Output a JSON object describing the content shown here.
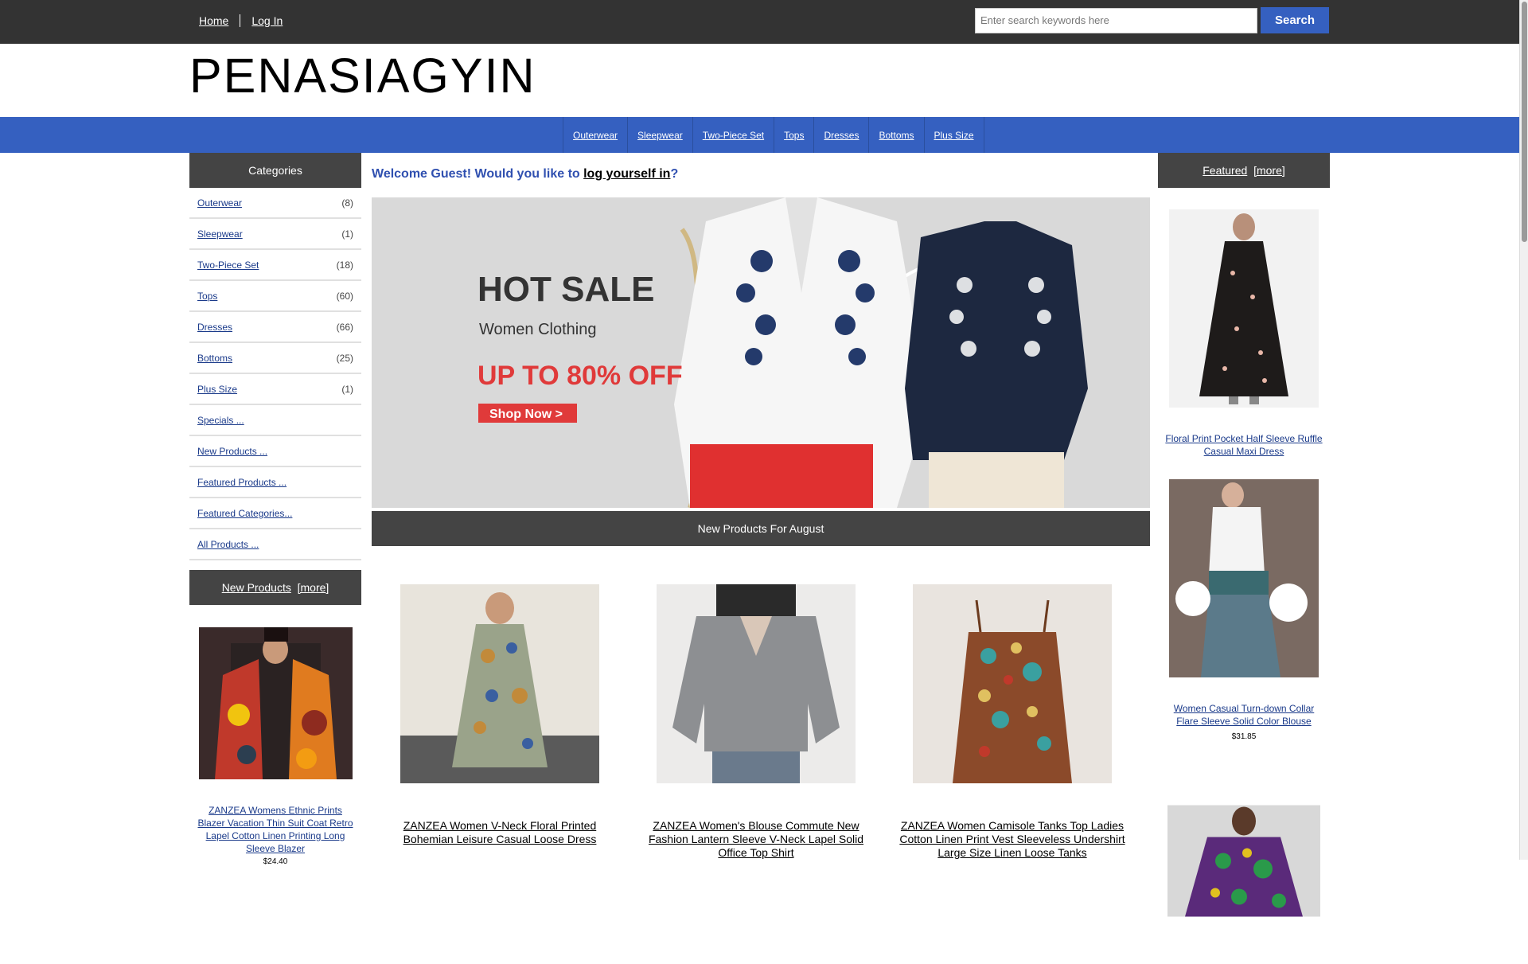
{
  "topbar": {
    "home_label": "Home",
    "login_label": "Log In",
    "search_placeholder": "Enter search keywords here",
    "search_button": "Search"
  },
  "logo": "PENASIAGYIN",
  "nav": [
    "Outerwear",
    "Sleepwear",
    "Two-Piece Set",
    "Tops",
    "Dresses",
    "Bottoms",
    "Plus Size"
  ],
  "categories": {
    "title": "Categories",
    "items": [
      {
        "label": "Outerwear",
        "count": "(8)"
      },
      {
        "label": "Sleepwear",
        "count": "(1)"
      },
      {
        "label": "Two-Piece Set",
        "count": "(18)"
      },
      {
        "label": "Tops",
        "count": "(60)"
      },
      {
        "label": "Dresses",
        "count": "(66)"
      },
      {
        "label": "Bottoms",
        "count": "(25)"
      },
      {
        "label": "Plus Size",
        "count": "(1)"
      }
    ],
    "links": [
      "Specials ...",
      "New Products ...",
      "Featured Products ...",
      "Featured Categories...",
      "All Products ..."
    ]
  },
  "new_products_box": {
    "title": "New Products",
    "more": "[more]",
    "item_title": "ZANZEA Womens Ethnic Prints Blazer Vacation Thin Suit Coat Retro Lapel Cotton Linen Printing Long Sleeve Blazer",
    "item_price": "$24.40"
  },
  "welcome": {
    "prefix": "Welcome Guest! Would you like to ",
    "link": "log yourself in",
    "suffix": "?"
  },
  "banner": {
    "headline": "HOT SALE",
    "subline": "Women Clothing",
    "offer": "UP TO 80% OFF",
    "cta": "Shop Now >"
  },
  "section_title": "New Products For August",
  "products": [
    {
      "title": "ZANZEA Women V-Neck Floral Printed Bohemian Leisure Casual Loose Dress"
    },
    {
      "title": "ZANZEA Women's Blouse Commute New Fashion Lantern Sleeve V-Neck Lapel Solid Office Top Shirt"
    },
    {
      "title": "ZANZEA Women Camisole Tanks Top Ladies Cotton Linen Print Vest Sleeveless Undershirt Large Size Linen Loose Tanks"
    }
  ],
  "featured": {
    "title": "Featured",
    "more": "[more]",
    "items": [
      {
        "title": "Floral Print Pocket Half Sleeve Ruffle Casual Maxi Dress",
        "price": ""
      },
      {
        "title": "Women Casual Turn-down Collar Flare Sleeve Solid Color Blouse",
        "price": "$31.85"
      }
    ]
  }
}
